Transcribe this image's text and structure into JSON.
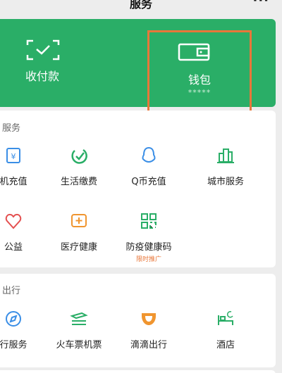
{
  "topbar": {
    "title": "服务",
    "more": "···"
  },
  "wallet_card": {
    "pay_label": "收付款",
    "wallet_label": "钱包",
    "wallet_mask": "*****"
  },
  "services": {
    "title": "服务",
    "items": [
      {
        "label": "机充值",
        "icon": "phone-recharge-icon"
      },
      {
        "label": "生活缴费",
        "icon": "life-payment-icon"
      },
      {
        "label": "Q币充值",
        "icon": "qq-coin-icon"
      },
      {
        "label": "城市服务",
        "icon": "city-service-icon"
      },
      {
        "label": "公益",
        "icon": "charity-icon"
      },
      {
        "label": "医疗健康",
        "icon": "medical-health-icon"
      },
      {
        "label": "防疫健康码",
        "icon": "health-code-icon",
        "tag": "限时推广"
      }
    ]
  },
  "travel": {
    "title": "出行",
    "items": [
      {
        "label": "行服务",
        "icon": "travel-service-icon"
      },
      {
        "label": "火车票机票",
        "icon": "train-ticket-icon"
      },
      {
        "label": "滴滴出行",
        "icon": "didi-icon"
      },
      {
        "label": "酒店",
        "icon": "hotel-icon"
      }
    ]
  },
  "colors": {
    "brand_green": "#2aae67",
    "highlight_orange": "#e8773a"
  }
}
